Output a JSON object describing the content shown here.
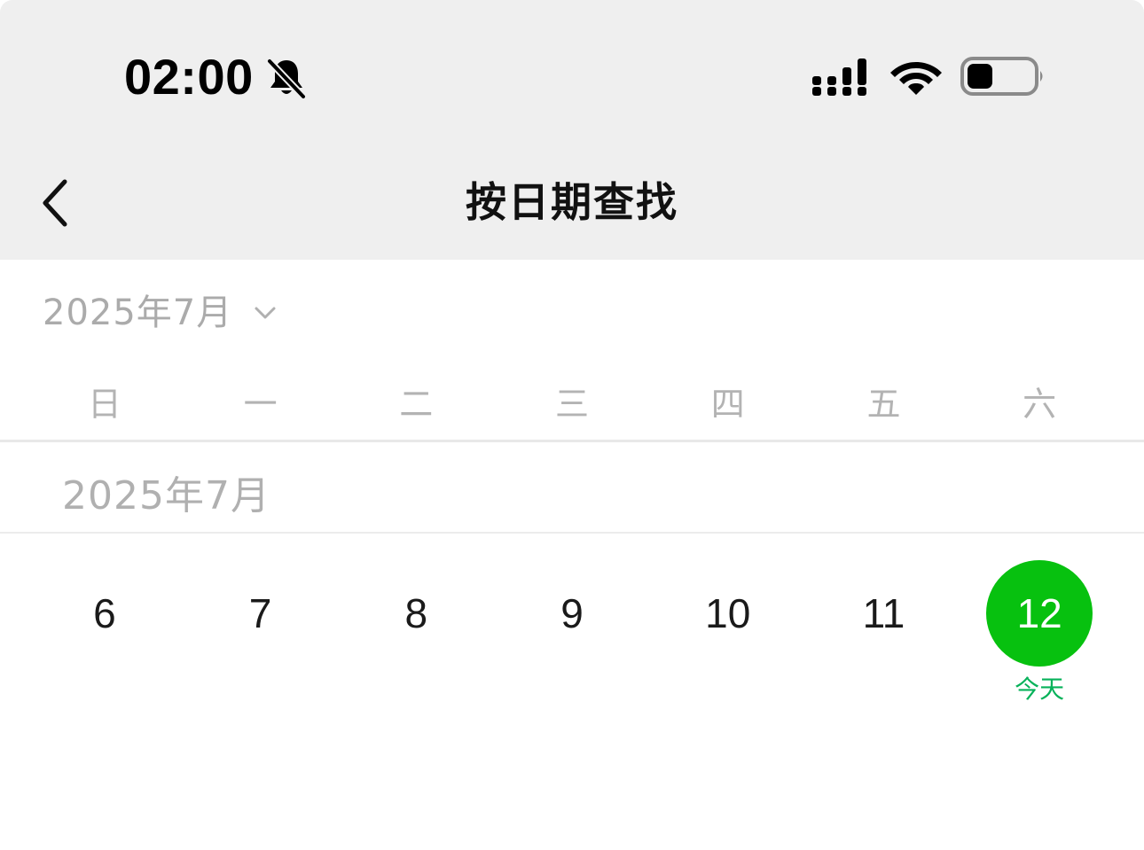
{
  "status_bar": {
    "time": "02:00",
    "icons": [
      "bell-muted-icon",
      "signal-icon",
      "wifi-icon",
      "battery-icon"
    ]
  },
  "nav": {
    "back_icon": "chevron-left-icon",
    "title": "按日期查找"
  },
  "month_picker": {
    "label": "2025年7月",
    "icon": "chevron-down-icon"
  },
  "weekdays": [
    "日",
    "一",
    "二",
    "三",
    "四",
    "五",
    "六"
  ],
  "section": {
    "month_label": "2025年7月"
  },
  "days": [
    {
      "number": "6",
      "sub": ""
    },
    {
      "number": "7",
      "sub": ""
    },
    {
      "number": "8",
      "sub": ""
    },
    {
      "number": "9",
      "sub": ""
    },
    {
      "number": "10",
      "sub": ""
    },
    {
      "number": "11",
      "sub": ""
    },
    {
      "number": "12",
      "sub": "今天",
      "today": true
    }
  ],
  "colors": {
    "today_accent": "#07c10f",
    "today_label": "#07b25a",
    "header_bg": "#efefef"
  }
}
